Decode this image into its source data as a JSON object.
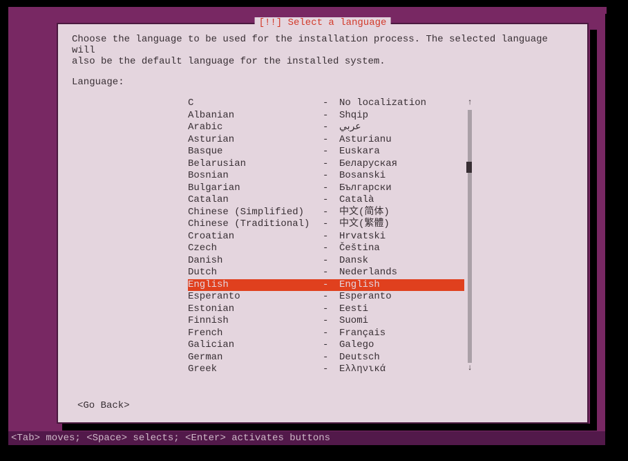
{
  "dialog": {
    "title": "[!!] Select a language",
    "instruction": "Choose the language to be used for the installation process. The selected language will\nalso be the default language for the installed system.",
    "label": "Language:",
    "go_back": "<Go Back>"
  },
  "languages": [
    {
      "name": "C",
      "native": "No localization",
      "selected": false
    },
    {
      "name": "Albanian",
      "native": "Shqip",
      "selected": false
    },
    {
      "name": "Arabic",
      "native": "عربي",
      "selected": false
    },
    {
      "name": "Asturian",
      "native": "Asturianu",
      "selected": false
    },
    {
      "name": "Basque",
      "native": "Euskara",
      "selected": false
    },
    {
      "name": "Belarusian",
      "native": "Беларуская",
      "selected": false
    },
    {
      "name": "Bosnian",
      "native": "Bosanski",
      "selected": false
    },
    {
      "name": "Bulgarian",
      "native": "Български",
      "selected": false
    },
    {
      "name": "Catalan",
      "native": "Català",
      "selected": false
    },
    {
      "name": "Chinese (Simplified)",
      "native": "中文(简体)",
      "selected": false
    },
    {
      "name": "Chinese (Traditional)",
      "native": "中文(繁體)",
      "selected": false
    },
    {
      "name": "Croatian",
      "native": "Hrvatski",
      "selected": false
    },
    {
      "name": "Czech",
      "native": "Čeština",
      "selected": false
    },
    {
      "name": "Danish",
      "native": "Dansk",
      "selected": false
    },
    {
      "name": "Dutch",
      "native": "Nederlands",
      "selected": false
    },
    {
      "name": "English",
      "native": "English",
      "selected": true
    },
    {
      "name": "Esperanto",
      "native": "Esperanto",
      "selected": false
    },
    {
      "name": "Estonian",
      "native": "Eesti",
      "selected": false
    },
    {
      "name": "Finnish",
      "native": "Suomi",
      "selected": false
    },
    {
      "name": "French",
      "native": "Français",
      "selected": false
    },
    {
      "name": "Galician",
      "native": "Galego",
      "selected": false
    },
    {
      "name": "German",
      "native": "Deutsch",
      "selected": false
    },
    {
      "name": "Greek",
      "native": "Ελληνικά",
      "selected": false
    }
  ],
  "help_bar": "<Tab> moves; <Space> selects; <Enter> activates buttons",
  "scroll_arrows": {
    "up": "↑",
    "down": "↓"
  },
  "dash": "-"
}
